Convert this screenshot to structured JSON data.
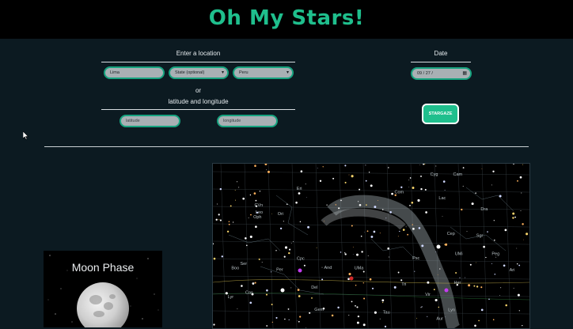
{
  "header": {
    "title": "Oh My Stars!"
  },
  "form": {
    "location_label": "Enter a location",
    "city_value": "Lima",
    "state_value": "State (optional)",
    "country_value": "Peru",
    "or_label": "or",
    "latlon_label": "latitude and longitude",
    "latitude_placeholder": "latitude",
    "longitude_placeholder": "longitude",
    "date_label": "Date",
    "date_value": "09 / 27 /",
    "submit_label": "STARGAZE"
  },
  "moon": {
    "title": "Moon Phase"
  },
  "star_map": {
    "labels": [
      "Cam",
      "Cep",
      "UMi",
      "Dra",
      "UMa",
      "Lyn",
      "Cas",
      "And",
      "Lac",
      "Cyg",
      "Her",
      "Boo",
      "CVn",
      "Leo",
      "Ari",
      "Tri",
      "Psc",
      "Peg",
      "Tau",
      "Aur",
      "Per",
      "Eri",
      "Vir",
      "Oph",
      "Ser",
      "Sgr",
      "Lyr",
      "Del",
      "Com",
      "Cnc",
      "Gem",
      "Ori"
    ]
  }
}
